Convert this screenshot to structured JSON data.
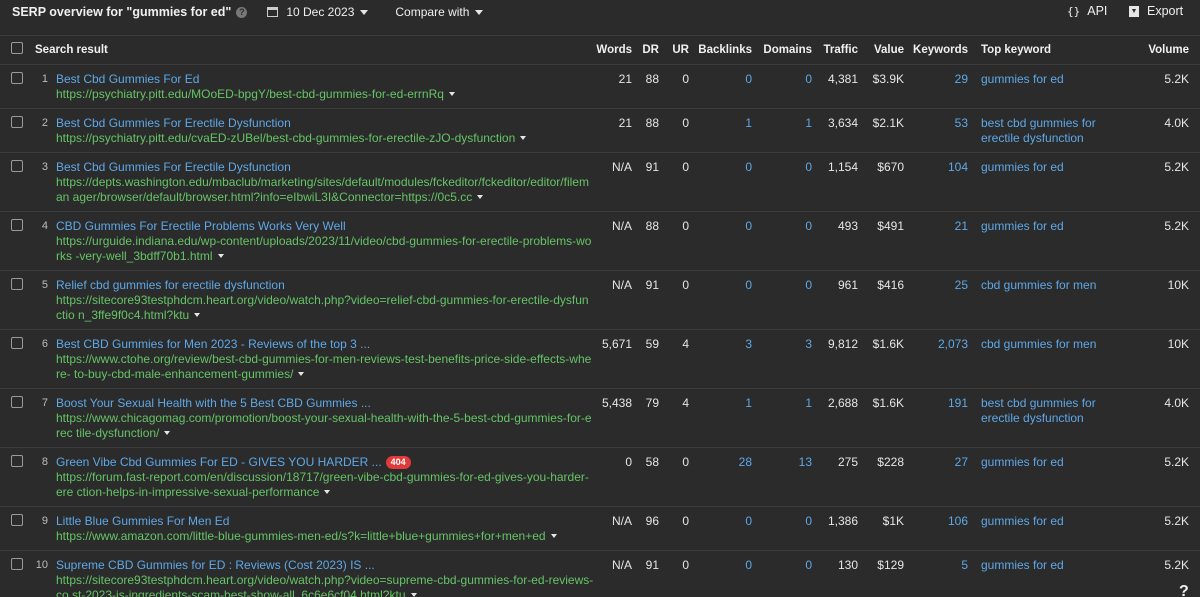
{
  "header": {
    "title": "SERP overview for \"gummies for ed\"",
    "date": "10 Dec 2023",
    "compare_label": "Compare with",
    "api_icon": "{}",
    "api_label": "API",
    "export_label": "Export"
  },
  "columns": {
    "result": "Search result",
    "words": "Words",
    "dr": "DR",
    "ur": "UR",
    "backlinks": "Backlinks",
    "domains": "Domains",
    "traffic": "Traffic",
    "value": "Value",
    "keywords": "Keywords",
    "top_keyword": "Top keyword",
    "volume": "Volume"
  },
  "rows": [
    {
      "rank": "1",
      "title": "Best Cbd Gummies For Ed",
      "url": "https://psychiatry.pitt.edu/MOoED-bpgY/best-cbd-gummies-for-ed-errnRq",
      "badge": "",
      "words": "21",
      "dr": "88",
      "ur": "0",
      "backlinks": "0",
      "domains": "0",
      "traffic": "4,381",
      "value": "$3.9K",
      "keywords": "29",
      "top_keyword": "gummies for ed",
      "volume": "5.2K"
    },
    {
      "rank": "2",
      "title": "Best Cbd Gummies For Erectile Dysfunction",
      "url": "https://psychiatry.pitt.edu/cvaED-zUBel/best-cbd-gummies-for-erectile-zJO-dysfunction",
      "badge": "",
      "words": "21",
      "dr": "88",
      "ur": "0",
      "backlinks": "1",
      "domains": "1",
      "traffic": "3,634",
      "value": "$2.1K",
      "keywords": "53",
      "top_keyword": "best cbd gummies for erectile dysfunction",
      "volume": "4.0K"
    },
    {
      "rank": "3",
      "title": "Best Cbd Gummies For Erectile Dysfunction",
      "url": "https://depts.washington.edu/mbaclub/marketing/sites/default/modules/fckeditor/fckeditor/editor/fileman ager/browser/default/browser.html?info=eIbwiL3I&Connector=https://0c5.cc",
      "badge": "",
      "words": "N/A",
      "dr": "91",
      "ur": "0",
      "backlinks": "0",
      "domains": "0",
      "traffic": "1,154",
      "value": "$670",
      "keywords": "104",
      "top_keyword": "gummies for ed",
      "volume": "5.2K"
    },
    {
      "rank": "4",
      "title": "CBD Gummies For Erectile Problems Works Very Well",
      "url": "https://urguide.indiana.edu/wp-content/uploads/2023/11/video/cbd-gummies-for-erectile-problems-works -very-well_3bdff70b1.html",
      "badge": "",
      "words": "N/A",
      "dr": "88",
      "ur": "0",
      "backlinks": "0",
      "domains": "0",
      "traffic": "493",
      "value": "$491",
      "keywords": "21",
      "top_keyword": "gummies for ed",
      "volume": "5.2K"
    },
    {
      "rank": "5",
      "title": "Relief cbd gummies for erectile dysfunction",
      "url": "https://sitecore93testphdcm.heart.org/video/watch.php?video=relief-cbd-gummies-for-erectile-dysfunctio n_3ffe9f0c4.html?ktu",
      "badge": "",
      "words": "N/A",
      "dr": "91",
      "ur": "0",
      "backlinks": "0",
      "domains": "0",
      "traffic": "961",
      "value": "$416",
      "keywords": "25",
      "top_keyword": "cbd gummies for men",
      "volume": "10K"
    },
    {
      "rank": "6",
      "title": "Best CBD Gummies for Men 2023 - Reviews of the top 3 ...",
      "url": "https://www.ctohe.org/review/best-cbd-gummies-for-men-reviews-test-benefits-price-side-effects-where- to-buy-cbd-male-enhancement-gummies/",
      "badge": "",
      "words": "5,671",
      "dr": "59",
      "ur": "4",
      "backlinks": "3",
      "domains": "3",
      "traffic": "9,812",
      "value": "$1.6K",
      "keywords": "2,073",
      "top_keyword": "cbd gummies for men",
      "volume": "10K"
    },
    {
      "rank": "7",
      "title": "Boost Your Sexual Health with the 5 Best CBD Gummies ...",
      "url": "https://www.chicagomag.com/promotion/boost-your-sexual-health-with-the-5-best-cbd-gummies-for-erec tile-dysfunction/",
      "badge": "",
      "words": "5,438",
      "dr": "79",
      "ur": "4",
      "backlinks": "1",
      "domains": "1",
      "traffic": "2,688",
      "value": "$1.6K",
      "keywords": "191",
      "top_keyword": "best cbd gummies for erectile dysfunction",
      "volume": "4.0K"
    },
    {
      "rank": "8",
      "title": "Green Vibe Cbd Gummies For ED - GIVES YOU HARDER ...",
      "url": "https://forum.fast-report.com/en/discussion/18717/green-vibe-cbd-gummies-for-ed-gives-you-harder-ere ction-helps-in-impressive-sexual-performance",
      "badge": "404",
      "words": "0",
      "dr": "58",
      "ur": "0",
      "backlinks": "28",
      "domains": "13",
      "traffic": "275",
      "value": "$228",
      "keywords": "27",
      "top_keyword": "gummies for ed",
      "volume": "5.2K"
    },
    {
      "rank": "9",
      "title": "Little Blue Gummies For Men Ed",
      "url": "https://www.amazon.com/little-blue-gummies-men-ed/s?k=little+blue+gummies+for+men+ed",
      "badge": "",
      "words": "N/A",
      "dr": "96",
      "ur": "0",
      "backlinks": "0",
      "domains": "0",
      "traffic": "1,386",
      "value": "$1K",
      "keywords": "106",
      "top_keyword": "gummies for ed",
      "volume": "5.2K"
    },
    {
      "rank": "10",
      "title": "Supreme CBD Gummies for ED : Reviews (Cost 2023) IS ...",
      "url": "https://sitecore93testphdcm.heart.org/video/watch.php?video=supreme-cbd-gummies-for-ed-reviews-co st-2023-is-ingredients-scam-best-show-all_6c6e6cf04.html?ktu",
      "badge": "",
      "words": "N/A",
      "dr": "91",
      "ur": "0",
      "backlinks": "0",
      "domains": "0",
      "traffic": "130",
      "value": "$129",
      "keywords": "5",
      "top_keyword": "gummies for ed",
      "volume": "5.2K"
    }
  ],
  "footer": {
    "help_label": "?"
  },
  "colors": {
    "background": "#2b2b2b",
    "link_blue": "#5ea8e8",
    "url_green": "#65c466",
    "badge_red": "#e03a3a"
  }
}
